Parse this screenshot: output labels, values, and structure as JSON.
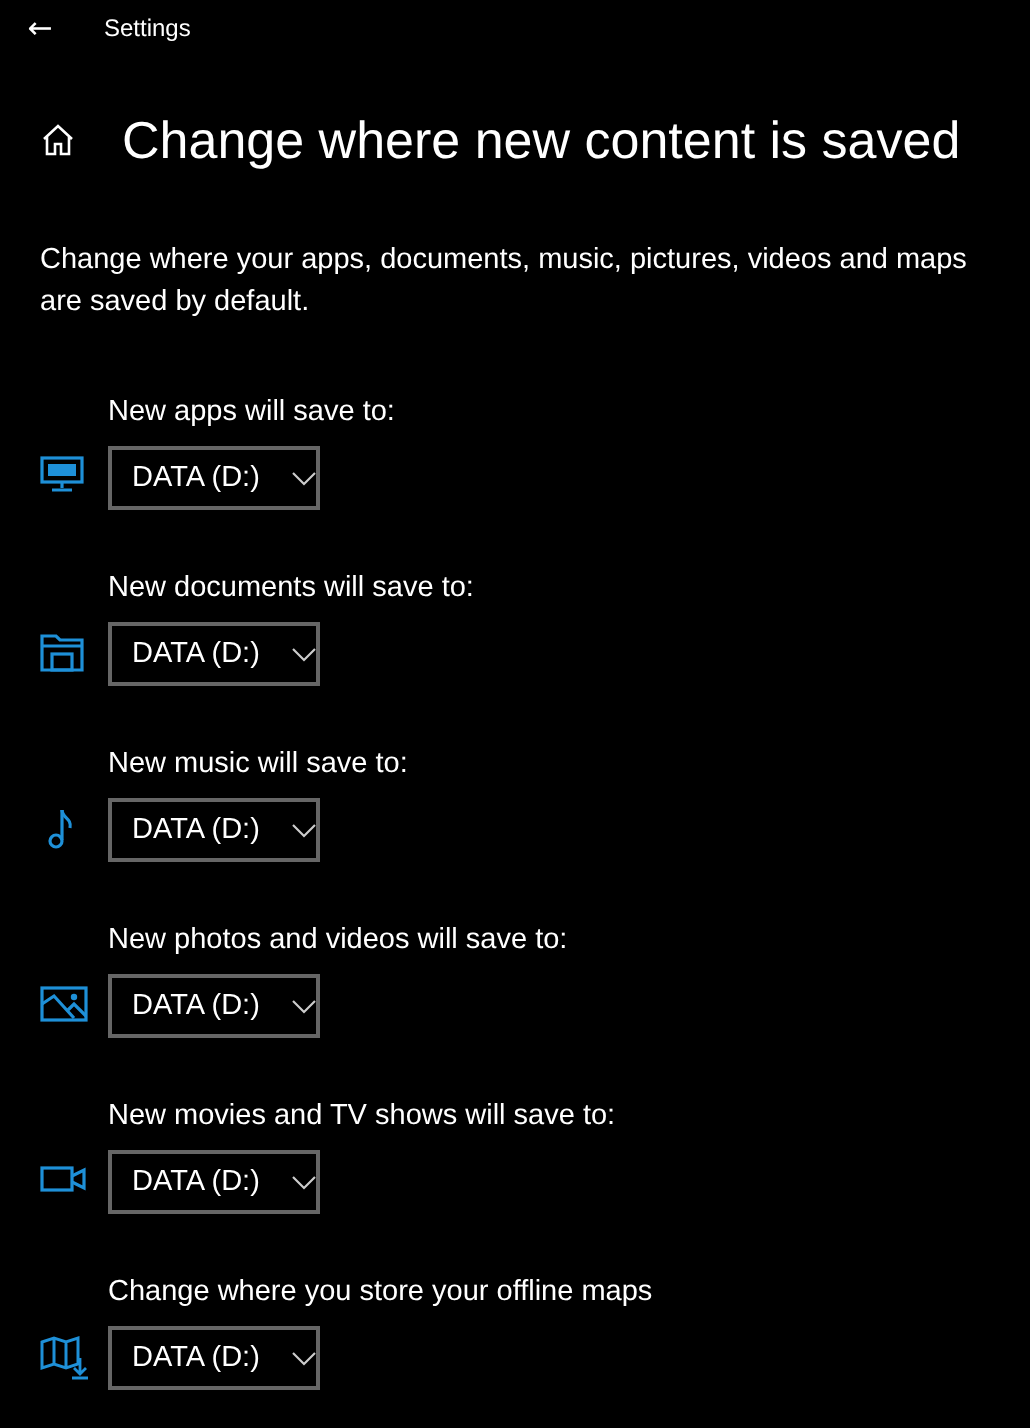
{
  "window": {
    "title": "Settings",
    "back": "←"
  },
  "page": {
    "title": "Change where new content is saved",
    "description": "Change where your apps, documents, music, pictures, videos and maps are saved by default."
  },
  "settings": [
    {
      "label": "New apps will save to:",
      "value": "DATA (D:)"
    },
    {
      "label": "New documents will save to:",
      "value": "DATA (D:)"
    },
    {
      "label": "New music will save to:",
      "value": "DATA (D:)"
    },
    {
      "label": "New photos and videos will save to:",
      "value": "DATA (D:)"
    },
    {
      "label": "New movies and TV shows will save to:",
      "value": "DATA (D:)"
    },
    {
      "label": "Change where you store your offline maps",
      "value": "DATA (D:)"
    }
  ]
}
